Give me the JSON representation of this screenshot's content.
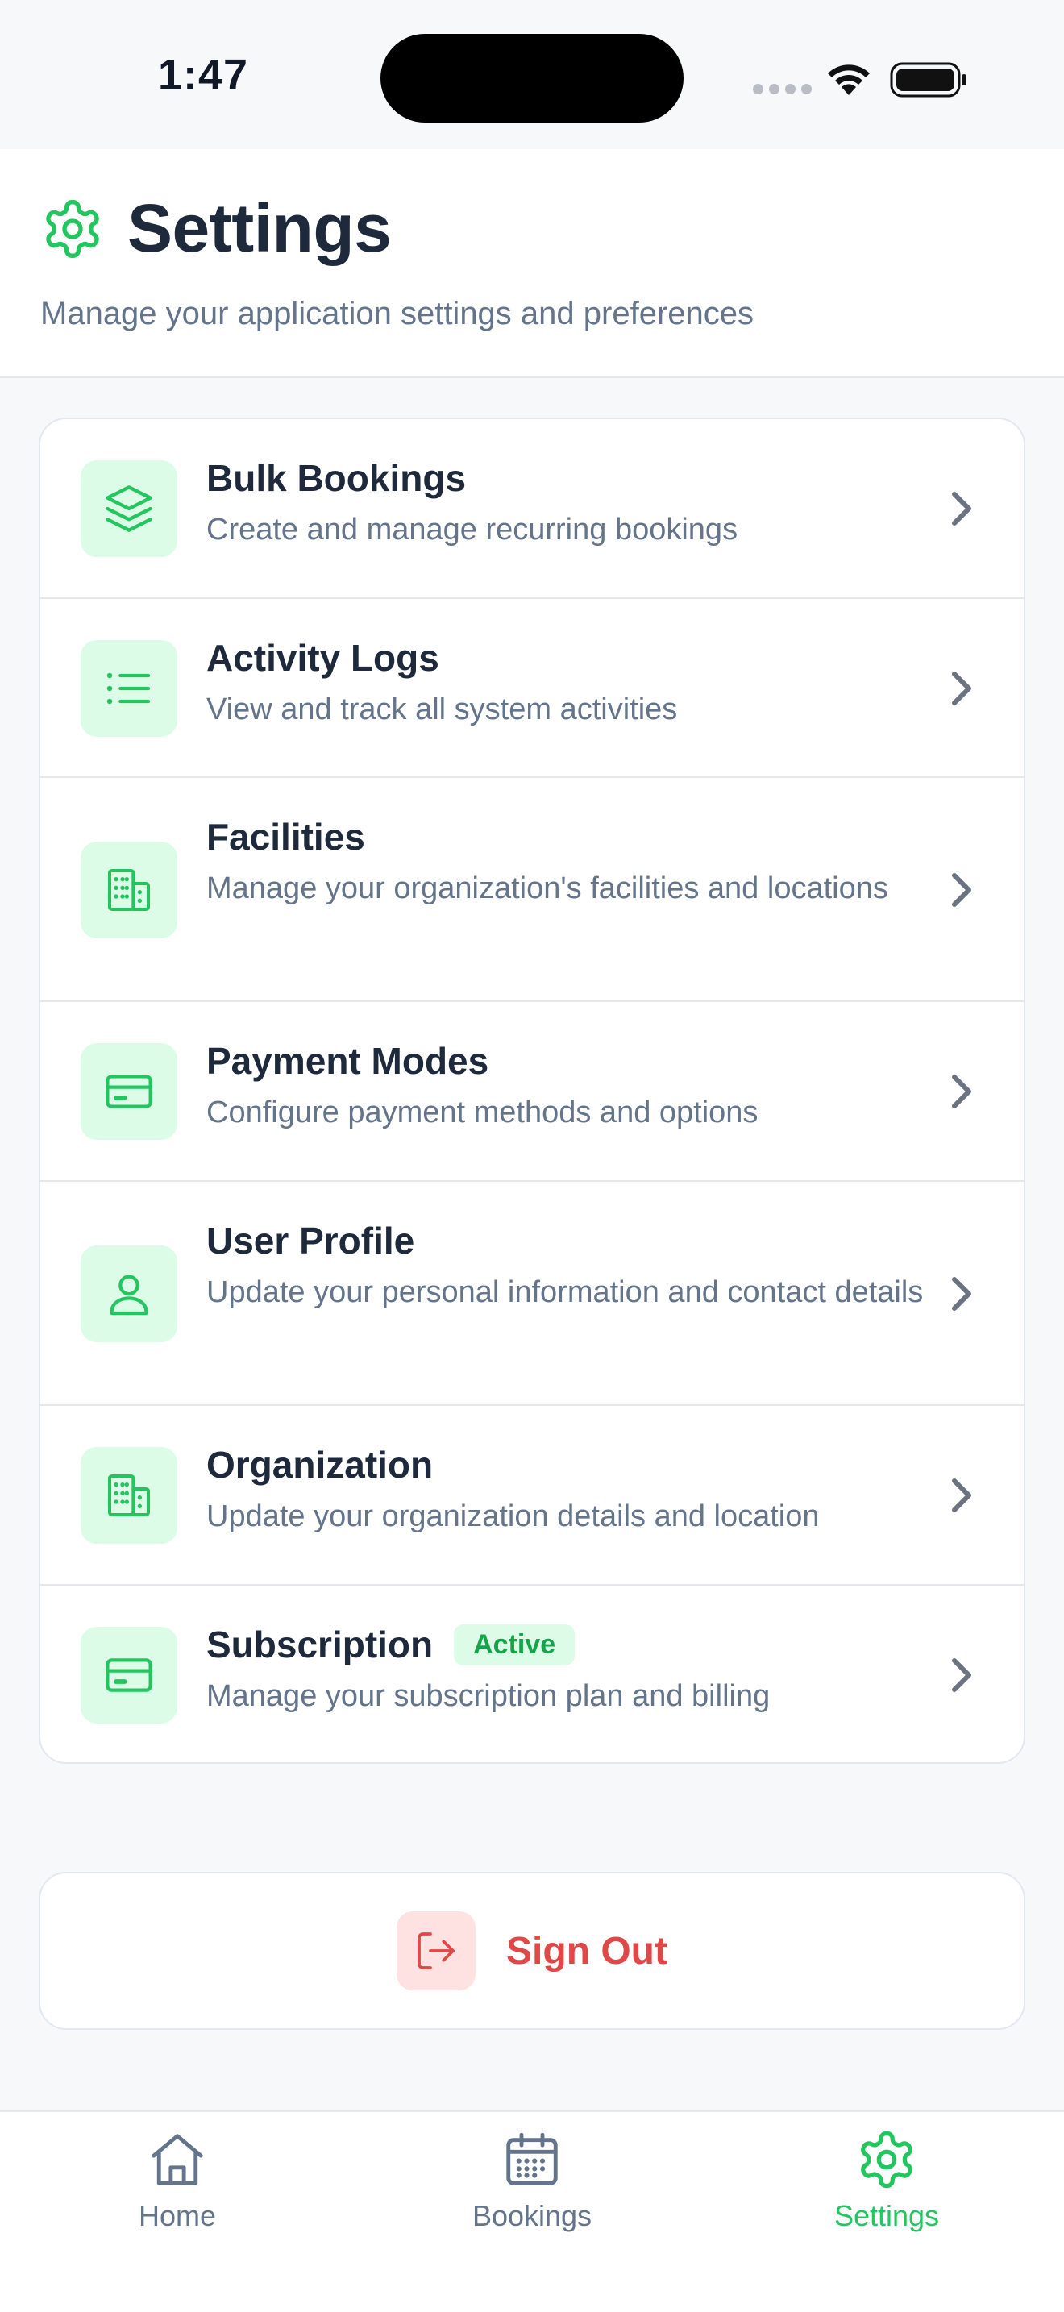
{
  "status_bar": {
    "time": "1:47"
  },
  "header": {
    "title": "Settings",
    "subtitle": "Manage your application settings and preferences"
  },
  "menu": {
    "items": [
      {
        "title": "Bulk Bookings",
        "description": "Create and manage recurring bookings",
        "icon": "layers-icon"
      },
      {
        "title": "Activity Logs",
        "description": "View and track all system activities",
        "icon": "list-icon"
      },
      {
        "title": "Facilities",
        "description": "Manage your organization's facilities and locations",
        "icon": "building-icon"
      },
      {
        "title": "Payment Modes",
        "description": "Configure payment methods and options",
        "icon": "credit-card-icon"
      },
      {
        "title": "User Profile",
        "description": "Update your personal information and contact details",
        "icon": "user-icon"
      },
      {
        "title": "Organization",
        "description": "Update your organization details and location",
        "icon": "building-icon"
      },
      {
        "title": "Subscription",
        "description": "Manage your subscription plan and billing",
        "icon": "credit-card-icon",
        "badge": "Active"
      }
    ]
  },
  "sign_out": {
    "label": "Sign Out"
  },
  "tab_bar": {
    "tabs": [
      {
        "label": "Home",
        "icon": "home-icon",
        "active": false
      },
      {
        "label": "Bookings",
        "icon": "calendar-icon",
        "active": false
      },
      {
        "label": "Settings",
        "icon": "gear-icon",
        "active": true
      }
    ]
  },
  "colors": {
    "accent": "#22c55e",
    "accent_bg": "#dcfce7",
    "danger": "#e04848",
    "danger_bg": "#fee2e2",
    "text_primary": "#1e293b",
    "text_secondary": "#64748b"
  }
}
